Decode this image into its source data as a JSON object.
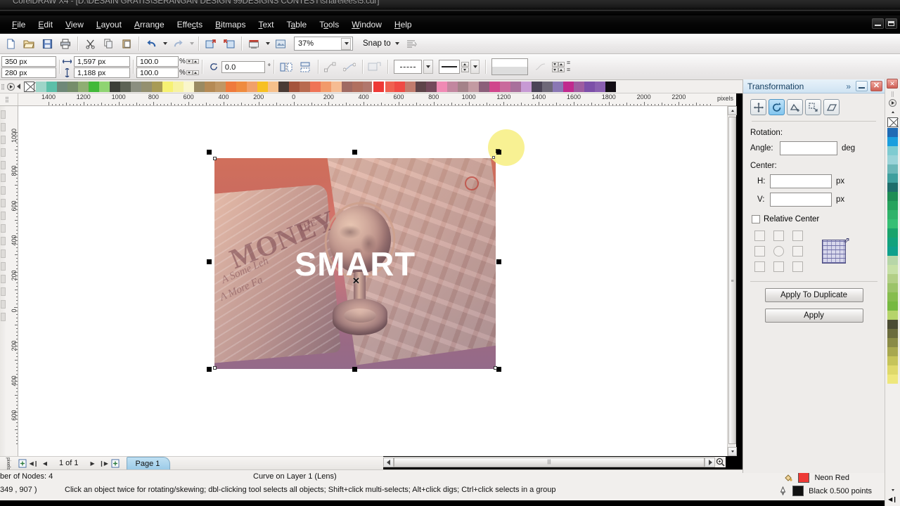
{
  "window": {
    "title": "CorelDRAW X4 - [D:\\DESAIN GRATIS\\SERANGAN DESIGN 99DESIGNS   CONTEST\\sharelees\\5.cdr]",
    "minimize": "–",
    "restore": "❐"
  },
  "menubar": {
    "items": [
      {
        "label": "File",
        "mnemonic": "F"
      },
      {
        "label": "Edit",
        "mnemonic": "E"
      },
      {
        "label": "View",
        "mnemonic": "V"
      },
      {
        "label": "Layout",
        "mnemonic": "L"
      },
      {
        "label": "Arrange",
        "mnemonic": "A"
      },
      {
        "label": "Effects",
        "mnemonic": "c"
      },
      {
        "label": "Bitmaps",
        "mnemonic": "B"
      },
      {
        "label": "Text",
        "mnemonic": "T"
      },
      {
        "label": "Table",
        "mnemonic": "a"
      },
      {
        "label": "Tools",
        "mnemonic": "o"
      },
      {
        "label": "Window",
        "mnemonic": "W"
      },
      {
        "label": "Help",
        "mnemonic": "H"
      }
    ]
  },
  "toolbar": {
    "new_label": "New",
    "open_label": "Open",
    "save_label": "Save",
    "print_label": "Print",
    "cut_label": "Cut",
    "copy_label": "Copy",
    "paste_label": "Paste",
    "undo_label": "Undo",
    "redo_label": "Redo",
    "import_label": "Import",
    "export_label": "Export",
    "app_launcher_label": "Application Launcher",
    "corel_online_label": "Corel Online",
    "zoom_level": "37%",
    "snap_label": "Snap to",
    "options_label": "Options"
  },
  "propertybar": {
    "object_x": "350 px",
    "object_y": "280 px",
    "object_width": "1,597 px",
    "object_height": "1,188 px",
    "scale_h": "100.0",
    "scale_v": "100.0",
    "percent_symbol": "%",
    "rotation_angle": "0.0",
    "degree_symbol": "°",
    "mirror_h_label": "Mirror Horizontally",
    "mirror_v_label": "Mirror Vertically",
    "to_front_label": "To Front",
    "to_back_label": "To Back",
    "convert_curves_label": "Convert To Curves",
    "outline_style_label": "Outline Style",
    "outline_width_label": "Outline Width",
    "wrap_text_label": "Wrap Paragraph Text",
    "edit_bitmap_label": "Edit Bitmap"
  },
  "rulers": {
    "horizontal_labels": [
      "1400",
      "1200",
      "1000",
      "800",
      "600",
      "400",
      "200",
      "0",
      "200",
      "400",
      "600",
      "800",
      "1000",
      "1200",
      "1400",
      "1600",
      "1800",
      "2000",
      "2200"
    ],
    "vertical_labels": [
      "1000",
      "800",
      "600",
      "400",
      "200",
      "0",
      "200",
      "400",
      "600"
    ],
    "unit": "pixels"
  },
  "canvas": {
    "artwork_text": "SMART",
    "bg_money_text": "MONEY",
    "bg_the_text": "THE",
    "bg_sub_text_1": "A Some Leh",
    "bg_sub_text_2": "A More Fa",
    "cursor_glyph": "✕"
  },
  "pagenav": {
    "first_label": "◀┃",
    "prev_label": "◀",
    "next_label": "▶",
    "last_label": "┃▶",
    "add_page_before_label": "+",
    "add_page_after_label": "+",
    "page_count": "1 of 1",
    "page_tab": "Page 1",
    "unit": "pixels"
  },
  "statusbar": {
    "nodes_label": "ber of Nodes: 4",
    "layer_label": "Curve on Layer 1  (Lens)",
    "coords": "349 , 907   )",
    "hint": "Click an object twice for rotating/skewing; dbl-clicking tool selects all objects; Shift+click multi-selects; Alt+click digs; Ctrl+click selects in a group",
    "fill_name": "Neon Red",
    "fill_color": "#ee3a36",
    "outline_name": "Black  0.500 points",
    "outline_color": "#111111",
    "fill_icon": "fill-icon",
    "outline_icon": "outline-pen-icon"
  },
  "docker": {
    "title": "Transformation",
    "chevron": "»",
    "minimize": "–",
    "close": "✕",
    "tabs": [
      {
        "name": "position",
        "label": "Position",
        "active": false
      },
      {
        "name": "rotation",
        "label": "Rotation",
        "active": true
      },
      {
        "name": "scale",
        "label": "Scale and Mirror",
        "active": false
      },
      {
        "name": "size",
        "label": "Size",
        "active": false
      },
      {
        "name": "skew",
        "label": "Skew",
        "active": false
      }
    ],
    "rotation_label": "Rotation:",
    "angle_label": "Angle:",
    "angle_value": "",
    "angle_unit": "deg",
    "center_label": "Center:",
    "h_label": "H:",
    "h_value": "",
    "h_unit": "px",
    "v_label": "V:",
    "v_value": "",
    "v_unit": "px",
    "relative_center_label": "Relative Center",
    "relative_center_checked": false,
    "apply_to_duplicate_label": "Apply To Duplicate",
    "apply_label": "Apply"
  },
  "palette": {
    "selected_swatch": "#ee3a36",
    "horizontal_colors": [
      "#9ed5c8",
      "#5cbfa8",
      "#6f8878",
      "#758d6a",
      "#8fae72",
      "#43b93a",
      "#8fd472",
      "#3c3f37",
      "#5d6355",
      "#8b8f80",
      "#94906f",
      "#a89b56",
      "#f6f173",
      "#f7f2a1",
      "#faf6cc",
      "#9a8a62",
      "#b58a55",
      "#c09764",
      "#ef7a3c",
      "#ef8b3f",
      "#f1a06a",
      "#f7c022",
      "#f6c08b",
      "#4a3b35",
      "#a5543c",
      "#b86a4f",
      "#ef7356",
      "#f29a6a",
      "#f6bc92",
      "#a06a62",
      "#b0705f",
      "#b1776c",
      "#ee3a36",
      "#ef6050",
      "#ef4a44",
      "#c17c6e",
      "#5e4449",
      "#74495b",
      "#f08ab4",
      "#c2879f",
      "#a48289",
      "#c39aa2",
      "#8b5f7a",
      "#d0468c",
      "#c96a9c",
      "#a8709b",
      "#c79ad4",
      "#4b4356",
      "#6e6878",
      "#8a77b4",
      "#c02a8e",
      "#9e5ca0",
      "#7c4fa8",
      "#8a5fb0",
      "#120d14"
    ],
    "vertical_colors": [
      "#1f6bb5",
      "#1b9ede",
      "#7fcbd1",
      "#9ad3d8",
      "#6cb7b8",
      "#3f9f9d",
      "#1f6e6b",
      "#1e8e55",
      "#26a35d",
      "#2fb36a",
      "#35bf74",
      "#19a36c",
      "#12a27d",
      "#0fa08c",
      "#b7d6a8",
      "#c6e0a6",
      "#b2cf86",
      "#9cc46a",
      "#86bd4e",
      "#76b940",
      "#b6d46b",
      "#4b4c33",
      "#6b6c3d",
      "#8a8b46",
      "#a8a84f",
      "#c6c45a",
      "#dfd96b",
      "#eee77c"
    ]
  }
}
